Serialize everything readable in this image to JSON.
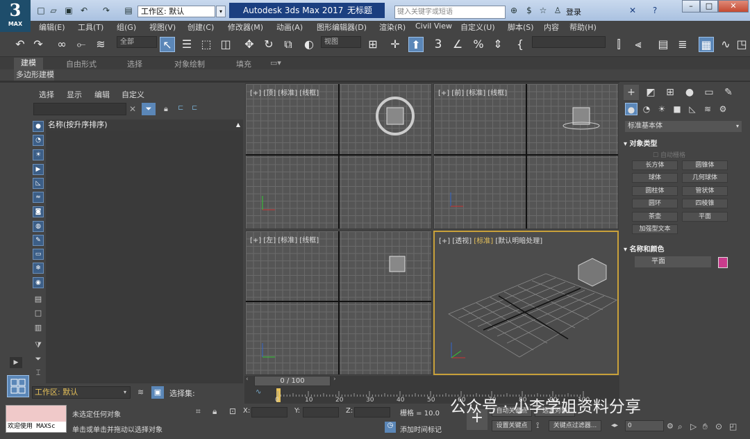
{
  "app": {
    "logo_num": "3",
    "logo_label": "MAX",
    "workspace_value": "工作区: 默认",
    "title": "Autodesk 3ds Max 2017",
    "doc_title": "无标题",
    "search_placeholder": "键入关键字或短语",
    "login": "登录"
  },
  "menu": [
    "编辑(E)",
    "工具(T)",
    "组(G)",
    "视图(V)",
    "创建(C)",
    "修改器(M)",
    "动画(A)",
    "图形编辑器(D)",
    "渲染(R)",
    "Civil View",
    "自定义(U)",
    "脚本(S)",
    "内容",
    "帮助(H)"
  ],
  "toolbar": {
    "selection_filter": "全部",
    "ref_coord": "视图",
    "named_selection": ""
  },
  "ribbon": {
    "tabs": [
      "建模",
      "自由形式",
      "选择",
      "对象绘制",
      "填充"
    ],
    "panel": "多边形建模"
  },
  "explorer": {
    "menu": [
      "选择",
      "显示",
      "编辑",
      "自定义"
    ],
    "column_header": "名称(按升序排序)",
    "workspace": "工作区: 默认",
    "selection_set_label": "选择集:"
  },
  "viewports": {
    "top": "[+] [顶] [标准] [线框]",
    "front": "[+] [前] [标准] [线框]",
    "left": "[+] [左] [标准] [线框]",
    "persp_plus": "[+]",
    "persp_name": "[透视]",
    "persp_std": "[标准]",
    "persp_light": "[默认明暗处理]"
  },
  "command_panel": {
    "category": "标准基本体",
    "object_type_title": "对象类型",
    "autogrid": "自动栅格",
    "buttons": [
      "长方体",
      "圆锥体",
      "球体",
      "几何球体",
      "圆柱体",
      "管状体",
      "圆环",
      "四棱锥",
      "茶壶",
      "平面",
      "加强型文本"
    ],
    "name_color_title": "名称和颜色",
    "object_name": "平面",
    "object_color": "#c83c8c"
  },
  "timeline": {
    "slider": "0 / 100",
    "ticks": [
      "0",
      "10",
      "20",
      "30",
      "40",
      "50",
      "60",
      "70",
      "80",
      "90",
      "100"
    ]
  },
  "status": {
    "maxscript": "欢迎使用 MAXSc",
    "line1": "未选定任何对象",
    "line2": "单击或单击并拖动以选择对象",
    "x_label": "X:",
    "y_label": "Y:",
    "z_label": "Z:",
    "grid": "栅格 = 10.0",
    "add_time_tag": "添加时间标记",
    "auto_key": "自动关键点",
    "selected_objects": "选定对象",
    "set_key": "设置关键点",
    "key_filters": "关键点过滤器...",
    "frame": "0"
  },
  "watermark": "公众号 · 小李学姐资料分享"
}
